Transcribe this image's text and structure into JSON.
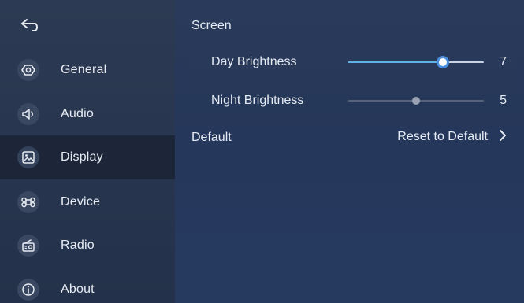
{
  "sidebar": {
    "back_icon": "back-arrow-icon",
    "items": [
      {
        "label": "General",
        "icon": "settings-hexagon-icon"
      },
      {
        "label": "Audio",
        "icon": "speaker-icon"
      },
      {
        "label": "Display",
        "icon": "picture-icon",
        "active": true
      },
      {
        "label": "Device",
        "icon": "command-key-icon"
      },
      {
        "label": "Radio",
        "icon": "radio-icon"
      },
      {
        "label": "About",
        "icon": "info-icon"
      }
    ]
  },
  "main": {
    "section_title": "Screen",
    "day": {
      "label": "Day Brightness",
      "value": "7",
      "level_fraction": 0.7
    },
    "night": {
      "label": "Night Brightness",
      "value": "5",
      "level_fraction": 0.5
    },
    "default": {
      "label": "Default",
      "action_label": "Reset to Default"
    }
  },
  "colors": {
    "sidebar_bg": "#2c3a53",
    "active_bg": "#1c2638",
    "main_bg": "#25375a",
    "slider_fill": "#5fb3e6",
    "knob_border": "#4a8ee0"
  }
}
